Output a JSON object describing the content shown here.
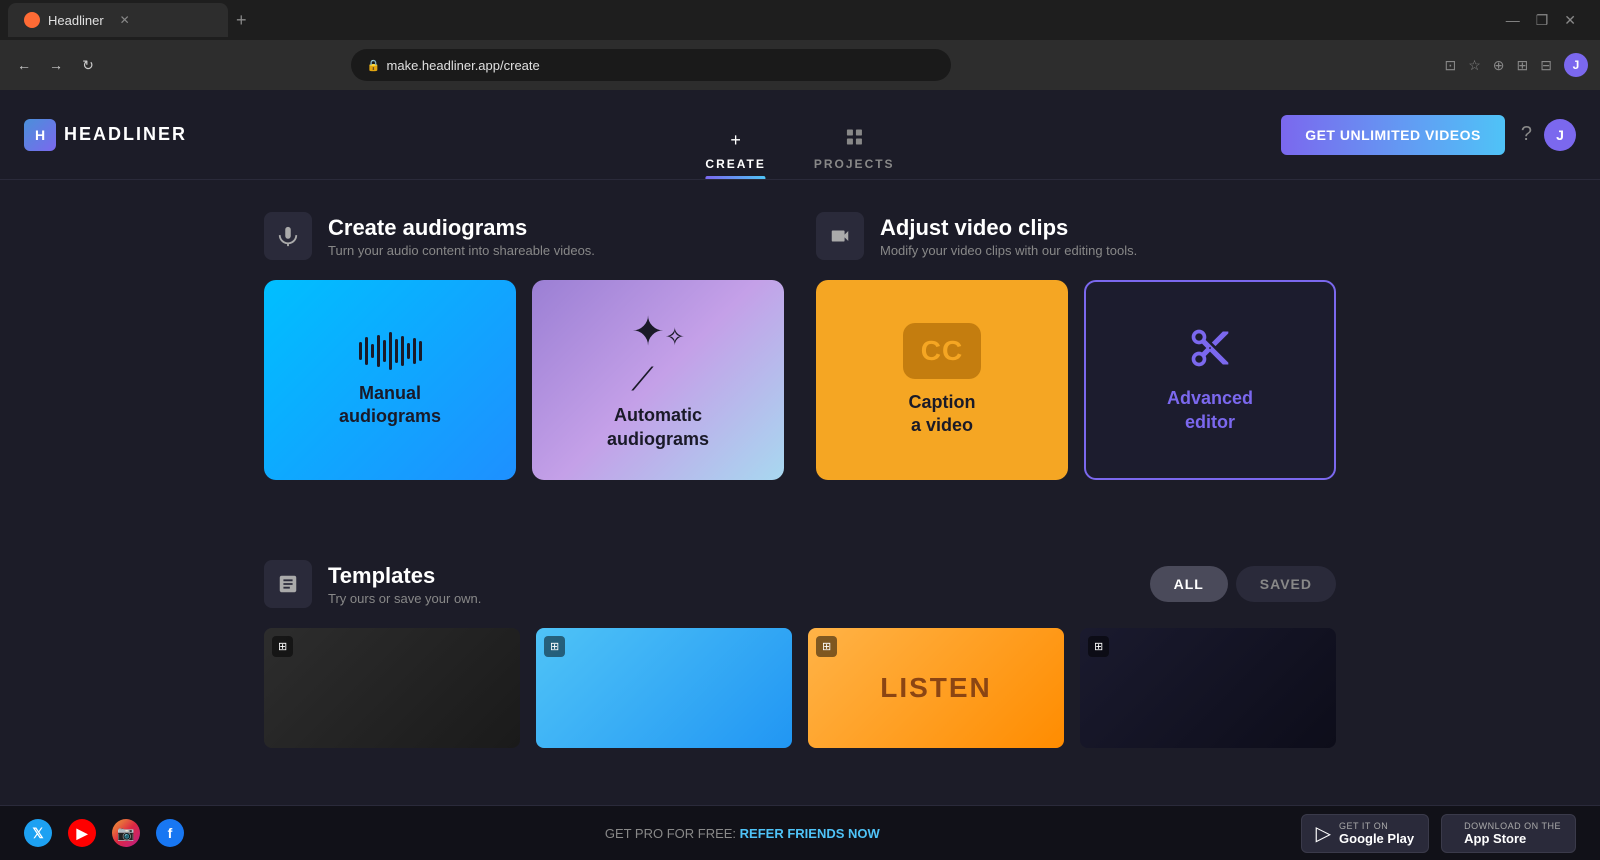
{
  "browser": {
    "tab_title": "Headliner",
    "url": "make.headliner.app/create",
    "new_tab_label": "+"
  },
  "nav": {
    "logo_initial": "H",
    "logo_text": "HEADLINER",
    "tabs": [
      {
        "id": "create",
        "icon": "➕",
        "label": "CREATE",
        "active": true
      },
      {
        "id": "projects",
        "icon": "🎬",
        "label": "PROJECTS",
        "active": false
      }
    ],
    "cta_button": "GET UNLIMITED VIDEOS",
    "help_icon": "?",
    "user_initial": "J"
  },
  "audiograms_section": {
    "icon": "🎙",
    "title": "Create audiograms",
    "subtitle": "Turn your audio content into shareable videos.",
    "cards": [
      {
        "id": "manual",
        "label": "Manual\naudiograms",
        "icon_type": "waveform"
      },
      {
        "id": "automatic",
        "label": "Automatic\naudiograms",
        "icon_type": "magic"
      }
    ]
  },
  "video_section": {
    "icon": "🎬",
    "title": "Adjust video clips",
    "subtitle": "Modify your video clips with our editing tools.",
    "cards": [
      {
        "id": "caption",
        "label": "Caption\na video",
        "icon_type": "cc"
      },
      {
        "id": "advanced",
        "label": "Advanced\neditor",
        "icon_type": "scissors"
      }
    ]
  },
  "templates_section": {
    "icon": "📋",
    "title": "Templates",
    "subtitle": "Try ours or save your own.",
    "filters": [
      {
        "id": "all",
        "label": "ALL",
        "active": true
      },
      {
        "id": "saved",
        "label": "SAVED",
        "active": false
      }
    ]
  },
  "bottom_bar": {
    "promo_text": "GET PRO FOR FREE:",
    "promo_link": "REFER FRIENDS NOW",
    "google_play": {
      "sub": "GET IT ON",
      "name": "Google Play"
    },
    "app_store": {
      "sub": "Download on the",
      "name": "App Store"
    }
  }
}
